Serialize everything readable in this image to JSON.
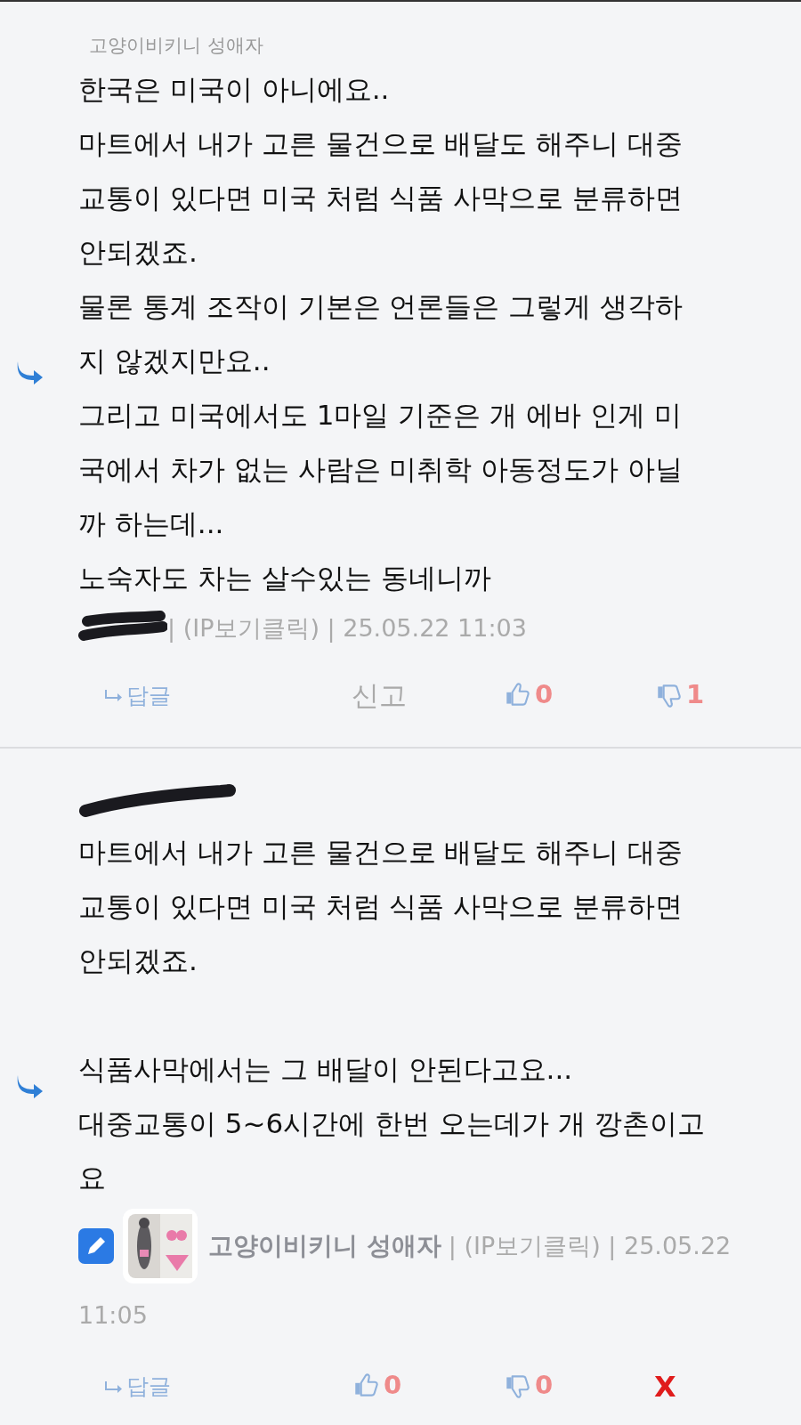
{
  "comments": [
    {
      "quoted_author": "고양이비키니 성애자",
      "quoted_redacted": false,
      "paragraphs": [
        [
          "한국은 미국이 아니에요..",
          "마트에서 내가 고른 물건으로 배달도 해주니 대중",
          "교통이 있다면 미국 처럼 식품 사막으로 분류하면",
          "안되겠죠.",
          "물론 통계 조작이 기본은 언론들은 그렇게 생각하",
          "지 않겠지만요..",
          "그리고 미국에서도 1마일 기준은 개 에바 인게 미",
          "국에서 차가 없는 사람은 미취학 아동정도가 아닐",
          "까 하는데...",
          "노숙자도 차는  살수있는 동네니까"
        ]
      ],
      "author_redacted": true,
      "own": false,
      "meta": "| (IP보기클릭) | 25.05.22 11:03",
      "actions": [
        {
          "kind": "reply",
          "label": "답글"
        },
        {
          "kind": "report",
          "label": "신고"
        },
        {
          "kind": "like",
          "count": "0"
        },
        {
          "kind": "dislike",
          "count": "1"
        }
      ]
    },
    {
      "quoted_redacted": true,
      "paragraphs": [
        [
          "마트에서 내가 고른 물건으로 배달도 해주니 대중",
          "교통이 있다면 미국 처럼 식품 사막으로 분류하면",
          "안되겠죠."
        ],
        [
          "식품사막에서는 그 배달이 안된다고요...",
          "대중교통이 5~6시간에 한번 오는데가 개 깡촌이고",
          "요"
        ]
      ],
      "author_redacted": false,
      "own": true,
      "avatar": {
        "kind": "picture"
      },
      "author": "고양이비키니 성애자",
      "meta": "| (IP보기클릭) | 25.05.22",
      "meta_wrap": "11:05",
      "actions": [
        {
          "kind": "reply",
          "label": "답글"
        },
        {
          "kind": "like",
          "count": "0"
        },
        {
          "kind": "dislike",
          "count": "0"
        },
        {
          "kind": "delete",
          "label": "X"
        }
      ]
    }
  ]
}
